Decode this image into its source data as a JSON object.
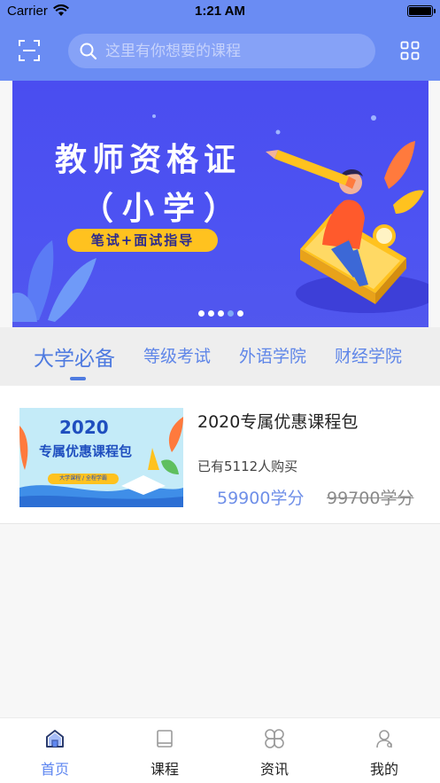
{
  "status_bar": {
    "carrier": "Carrier",
    "time": "1:21 AM"
  },
  "header": {
    "search_placeholder": "这里有你想要的课程",
    "icons": [
      "scan-icon",
      "search-icon",
      "grid-icon"
    ]
  },
  "banner": {
    "title": "教师资格证",
    "subtitle": "（小学）",
    "tag": "笔试+面试指导",
    "carousel_dots": 5,
    "active_dot_index": 3
  },
  "tabs": [
    {
      "label": "大学必备",
      "active": true
    },
    {
      "label": "等级考试",
      "active": false
    },
    {
      "label": "外语学院",
      "active": false
    },
    {
      "label": "财经学院",
      "active": false
    }
  ],
  "courses": [
    {
      "title": "2020专属优惠课程包",
      "buyers": "已有5112人购买",
      "price": "59900学分",
      "original_price": "99700学分",
      "thumb": {
        "year": "2020",
        "title": "专属优惠课程包",
        "tag": "大学课程 / 全程学霸"
      }
    }
  ],
  "tabbar": [
    {
      "label": "首页",
      "icon": "home-icon",
      "active": true
    },
    {
      "label": "课程",
      "icon": "book-icon",
      "active": false
    },
    {
      "label": "资讯",
      "icon": "news-icon",
      "active": false
    },
    {
      "label": "我的",
      "icon": "profile-icon",
      "active": false
    }
  ],
  "colors": {
    "header_bg": "#6a8cf3",
    "accent": "#5e86f0",
    "banner_bg": "#4a4df0",
    "tag_yellow": "#ffc21f"
  }
}
